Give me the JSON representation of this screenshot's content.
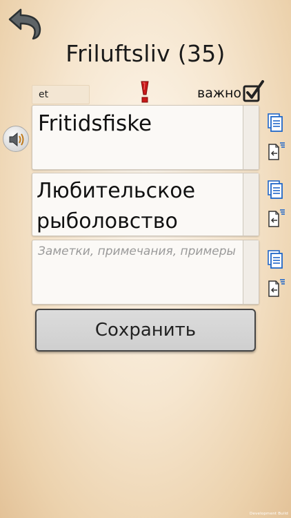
{
  "header": {
    "title": "Friluftsliv (35)"
  },
  "language_tag": "et",
  "important": {
    "label": "важно",
    "checked": true
  },
  "fields": {
    "word": {
      "value": "Fritidsfiske"
    },
    "translation": {
      "value": "Любительское рыболовство"
    },
    "notes": {
      "value": "",
      "placeholder": "Заметки, примечания, примеры"
    }
  },
  "save_label": "Сохранить",
  "footer_text": "Development Build",
  "icons": {
    "back": "back-arrow-icon",
    "exclaim": "exclamation-icon",
    "checkbox": "checkbox-checked-icon",
    "speaker": "speaker-icon",
    "copy": "copy-document-icon",
    "paste": "paste-document-icon"
  },
  "colors": {
    "accent_blue": "#1e66c9",
    "exclaim_red": "#c81818"
  }
}
